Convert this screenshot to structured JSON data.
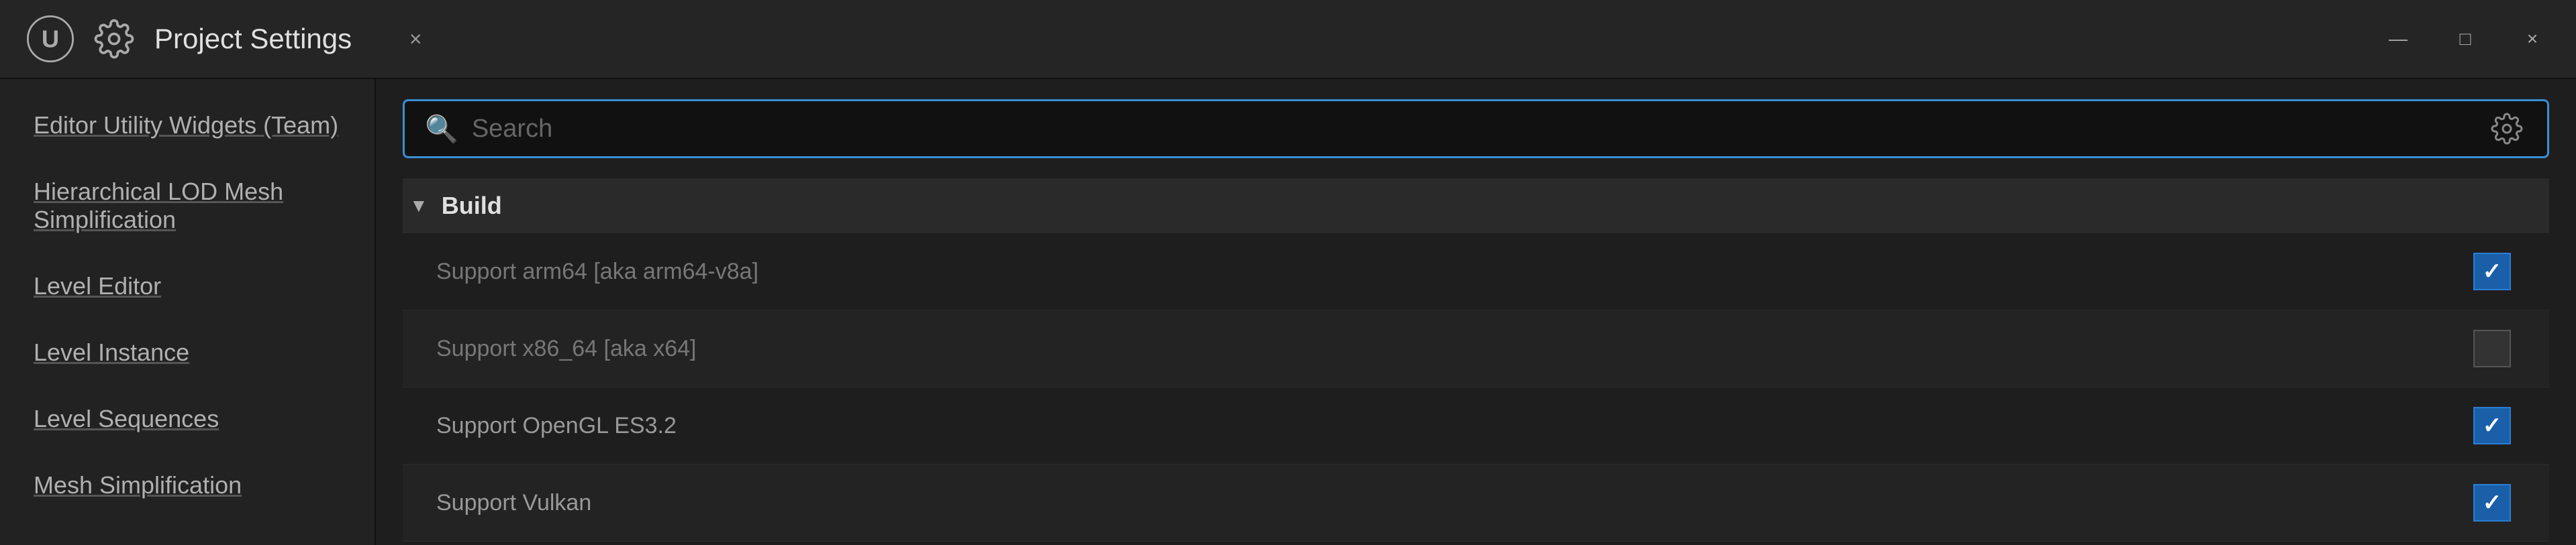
{
  "window": {
    "title": "Project Settings",
    "close_label": "×",
    "minimize_label": "—",
    "maximize_label": "□"
  },
  "sidebar": {
    "items": [
      {
        "label": "Editor Utility Widgets (Team)"
      },
      {
        "label": "Hierarchical LOD Mesh Simplification"
      },
      {
        "label": "Level Editor"
      },
      {
        "label": "Level Instance"
      },
      {
        "label": "Level Sequences"
      },
      {
        "label": "Mesh Simplification"
      }
    ]
  },
  "search": {
    "placeholder": "Search",
    "value": ""
  },
  "settings": {
    "section_title": "Build",
    "rows": [
      {
        "label": "Support arm64 [aka arm64-v8a]",
        "checked": true,
        "dimmed": true
      },
      {
        "label": "Support x86_64 [aka x64]",
        "checked": false,
        "dimmed": true
      },
      {
        "label": "Support OpenGL ES3.2",
        "checked": true,
        "dimmed": false
      },
      {
        "label": "Support Vulkan",
        "checked": true,
        "dimmed": false
      }
    ]
  }
}
